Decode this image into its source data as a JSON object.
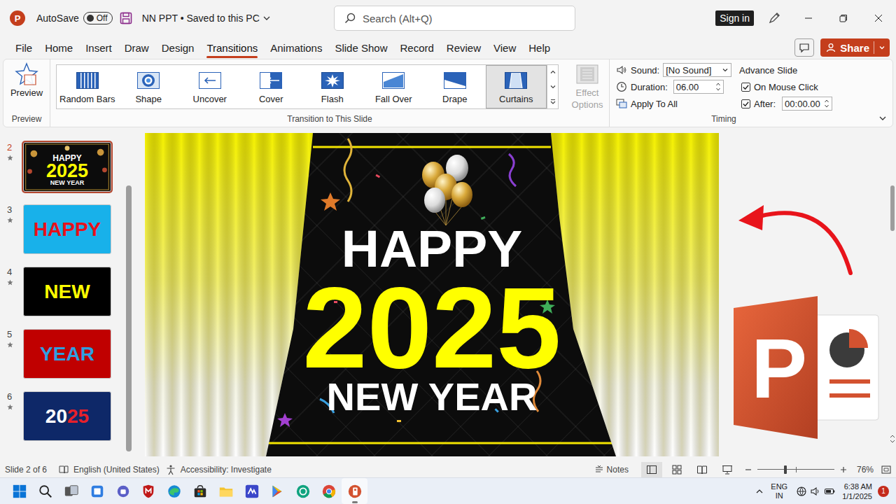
{
  "title_bar": {
    "app_icon": "P",
    "autosave": {
      "label": "AutoSave",
      "state": "Off",
      "on": false
    },
    "document": "NN PPT • Saved to this PC",
    "search": {
      "placeholder": "Search (Alt+Q)"
    },
    "sign_in": "Sign in"
  },
  "menu": {
    "tabs": [
      {
        "label": "File",
        "selected": false
      },
      {
        "label": "Home",
        "selected": false
      },
      {
        "label": "Insert",
        "selected": false
      },
      {
        "label": "Draw",
        "selected": false
      },
      {
        "label": "Design",
        "selected": false
      },
      {
        "label": "Transitions",
        "selected": true
      },
      {
        "label": "Animations",
        "selected": false
      },
      {
        "label": "Slide Show",
        "selected": false
      },
      {
        "label": "Record",
        "selected": false
      },
      {
        "label": "Review",
        "selected": false
      },
      {
        "label": "View",
        "selected": false
      },
      {
        "label": "Help",
        "selected": false
      }
    ],
    "share": "Share"
  },
  "ribbon": {
    "preview": {
      "button": "Preview",
      "group_label": "Preview"
    },
    "transitions": {
      "items": [
        {
          "label": "Random Bars",
          "kind": "bars",
          "selected": false
        },
        {
          "label": "Shape",
          "kind": "shape",
          "selected": false
        },
        {
          "label": "Uncover",
          "kind": "uncover",
          "selected": false
        },
        {
          "label": "Cover",
          "kind": "cover",
          "selected": false
        },
        {
          "label": "Flash",
          "kind": "flash",
          "selected": false
        },
        {
          "label": "Fall Over",
          "kind": "fallover",
          "selected": false
        },
        {
          "label": "Drape",
          "kind": "drape",
          "selected": false
        },
        {
          "label": "Curtains",
          "kind": "curtains",
          "selected": true
        }
      ],
      "effect_options": {
        "label": "Effect Options",
        "disabled": true
      },
      "group_label": "Transition to This Slide"
    },
    "timing": {
      "sound": {
        "label": "Sound:",
        "value": "[No Sound]"
      },
      "duration": {
        "label": "Duration:",
        "value": "06.00"
      },
      "apply_all": "Apply To All",
      "advance": {
        "title": "Advance Slide",
        "on_mouse_click": {
          "label": "On Mouse Click",
          "checked": true
        },
        "after": {
          "label": "After:",
          "checked": true,
          "value": "00:00.00"
        }
      },
      "group_label": "Timing"
    }
  },
  "slides": [
    {
      "number": "2",
      "selected": true,
      "transition": true,
      "kind": "curtain",
      "color": "#0c0c0c",
      "lines": [
        {
          "parts": [
            {
              "text": "HAPPY",
              "color": "#ffffff"
            }
          ]
        },
        {
          "parts": [
            {
              "text": "2025",
              "color": "#ffff00"
            }
          ]
        },
        {
          "parts": [
            {
              "text": "NEW YEAR",
              "color": "#ffffff"
            }
          ]
        }
      ]
    },
    {
      "number": "3",
      "selected": false,
      "transition": true,
      "kind": "word",
      "color": "#18b1ea",
      "lines": [
        {
          "parts": [
            {
              "text": "HAPPY",
              "color": "#e8101a"
            }
          ]
        }
      ]
    },
    {
      "number": "4",
      "selected": false,
      "transition": true,
      "kind": "word",
      "color": "#000000",
      "lines": [
        {
          "parts": [
            {
              "text": "NEW",
              "color": "#ffff00"
            }
          ]
        }
      ]
    },
    {
      "number": "5",
      "selected": false,
      "transition": true,
      "kind": "word",
      "color": "#c00000",
      "lines": [
        {
          "parts": [
            {
              "text": "YEAR",
              "color": "#2f9fe0"
            }
          ]
        }
      ]
    },
    {
      "number": "6",
      "selected": false,
      "transition": true,
      "kind": "word",
      "color": "#0e2868",
      "lines": [
        {
          "parts": [
            {
              "text": "20",
              "color": "#ffffff"
            },
            {
              "text": "25",
              "color": "#e8202a"
            }
          ]
        }
      ]
    }
  ],
  "overlay": {
    "logo_letter": "P"
  },
  "status_bar": {
    "slide": "Slide 2 of 6",
    "language": "English (United States)",
    "accessibility": "Accessibility: Investigate",
    "notes": "Notes",
    "zoom": {
      "level": 0.36,
      "reading": "76%"
    }
  },
  "taskbar": {
    "apps": [
      {
        "kind": "start",
        "running": false
      },
      {
        "kind": "search",
        "running": false
      },
      {
        "kind": "taskview",
        "running": false
      },
      {
        "kind": "widgets",
        "running": false
      },
      {
        "kind": "teams",
        "running": false
      },
      {
        "kind": "mcafee",
        "running": false
      },
      {
        "kind": "edge",
        "running": false
      },
      {
        "kind": "store",
        "running": false
      },
      {
        "kind": "explorer",
        "running": false
      },
      {
        "kind": "editor",
        "running": false
      },
      {
        "kind": "play",
        "running": false
      },
      {
        "kind": "chatgpt",
        "running": false
      },
      {
        "kind": "chrome",
        "running": false
      },
      {
        "kind": "powerpoint",
        "running": true
      }
    ],
    "tray": {
      "language": "ENG",
      "region": "IN",
      "time": "6:38 AM",
      "date": "1/1/2025",
      "badge": "1"
    }
  }
}
